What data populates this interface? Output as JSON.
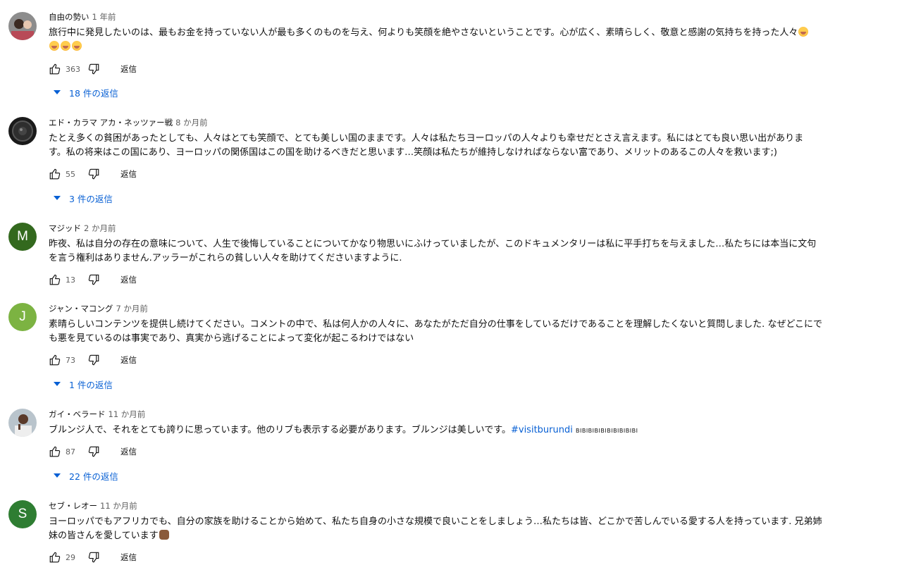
{
  "ui": {
    "reply_label": "返信",
    "accent": "#065fd4"
  },
  "comments": [
    {
      "author": "自由の勢い",
      "time": "1 年前",
      "text_lines": [
        "旅行中に発見したいのは、最もお金を持っていない人が最も多くのものを与え、何よりも笑顔を絶やさないということです。心が広く、素晴らしく、敬意と感謝の気持ちを持った人々"
      ],
      "emoji": "smiling-face-with-hearts",
      "likes": "363",
      "replies_label": "18 件の返信",
      "avatar": {
        "type": "photo",
        "color": "#6d6d6d"
      }
    },
    {
      "author": "エド・カラマ アカ・ネッツァー戦",
      "time": "8 か月前",
      "text_lines": [
        "たとえ多くの貧困があったとしても、人々はとても笑顔で、とても美しい国のままです。人々は私たちヨーロッパの人々よりも幸せだとさえ言えます。私にはとても良い思い出がありま",
        "す。私の将来はこの国にあり、ヨーロッパの関係国はこの国を助けるべきだと思います…笑顔は私たちが維持しなければならない富であり、メリットのあるこの人々を救います;)"
      ],
      "likes": "55",
      "replies_label": "3 件の返信",
      "avatar": {
        "type": "photo",
        "color": "#1a1a1a"
      }
    },
    {
      "author": "マジッド",
      "time": "2 か月前",
      "text_lines": [
        "昨夜、私は自分の存在の意味について、人生で後悔していることについてかなり物思いにふけっていましたが、このドキュメンタリーは私に平手打ちを与えました…私たちには本当に文句",
        "を言う権利はありません.アッラーがこれらの貧しい人々を助けてくださいますように."
      ],
      "likes": "13",
      "avatar": {
        "type": "letter",
        "letter": "M",
        "color": "#33691e"
      }
    },
    {
      "author": "ジャン・マコング",
      "time": "7 か月前",
      "text_lines": [
        "素晴らしいコンテンツを提供し続けてください。コメントの中で、私は何人かの人々に、あなたがただ自分の仕事をしているだけであることを理解したくないと質問しました. なぜどこにで",
        "も悪を見ているのは事実であり、真実から逃げることによって変化が起こるわけではない"
      ],
      "likes": "73",
      "replies_label": "1 件の返信",
      "avatar": {
        "type": "letter",
        "letter": "J",
        "color": "#7cb342"
      }
    },
    {
      "author": "ガイ・ベラード",
      "time": "11 か月前",
      "text_lines": [
        "ブルンジ人で、それをとても誇りに思っています。他のリブも表示する必要があります。ブルンジは美しいです。"
      ],
      "hashtag": "#visitburundi",
      "suffix": "BIBIBIBIBIBIBIBIBIBI",
      "likes": "87",
      "replies_label": "22 件の返信",
      "avatar": {
        "type": "photo",
        "color": "#8c9aa6"
      }
    },
    {
      "author": "セブ・レオー",
      "time": "11 か月前",
      "text_lines": [
        "ヨーロッパでもアフリカでも、自分の家族を助けることから始めて、私たち自身の小さな規模で良いことをしましょう…私たちは皆、どこかで苦しんでいる愛する人を持っています. 兄弟姉",
        "妹の皆さんを愛しています"
      ],
      "emoji": "fist",
      "likes": "29",
      "avatar": {
        "type": "letter",
        "letter": "S",
        "color": "#2e7d32"
      }
    }
  ]
}
